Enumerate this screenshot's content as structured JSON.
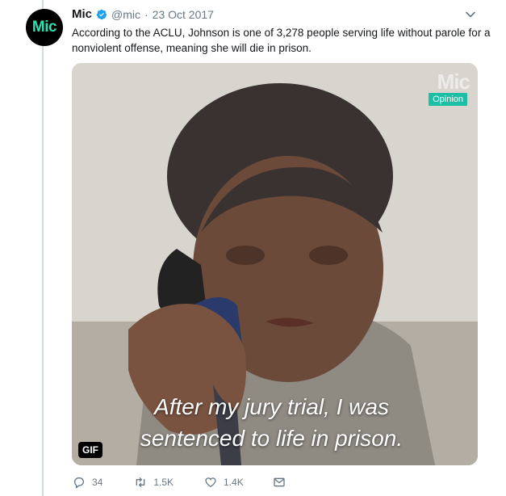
{
  "tweet": {
    "avatar_text": "Mic",
    "name": "Mic",
    "handle": "@mic",
    "separator": "·",
    "date": "23 Oct 2017",
    "text": "According to the ACLU, Johnson is one of 3,278 people serving life without parole for a nonviolent offense, meaning she will die in prison."
  },
  "media": {
    "watermark": "Mic",
    "badge": "Opinion",
    "caption_line1": "After my jury trial, I was",
    "caption_line2": "sentenced to life in prison.",
    "type_badge": "GIF"
  },
  "actions": {
    "replies": "34",
    "retweets": "1.5K",
    "likes": "1.4K"
  },
  "colors": {
    "brand": "#2de0b4",
    "verified": "#1da1f2",
    "opinion_badge": "#1cbfa4",
    "muted": "#657786"
  },
  "icons": [
    "verified-badge-icon",
    "chevron-down-icon",
    "reply-icon",
    "retweet-icon",
    "like-icon",
    "direct-message-icon"
  ]
}
